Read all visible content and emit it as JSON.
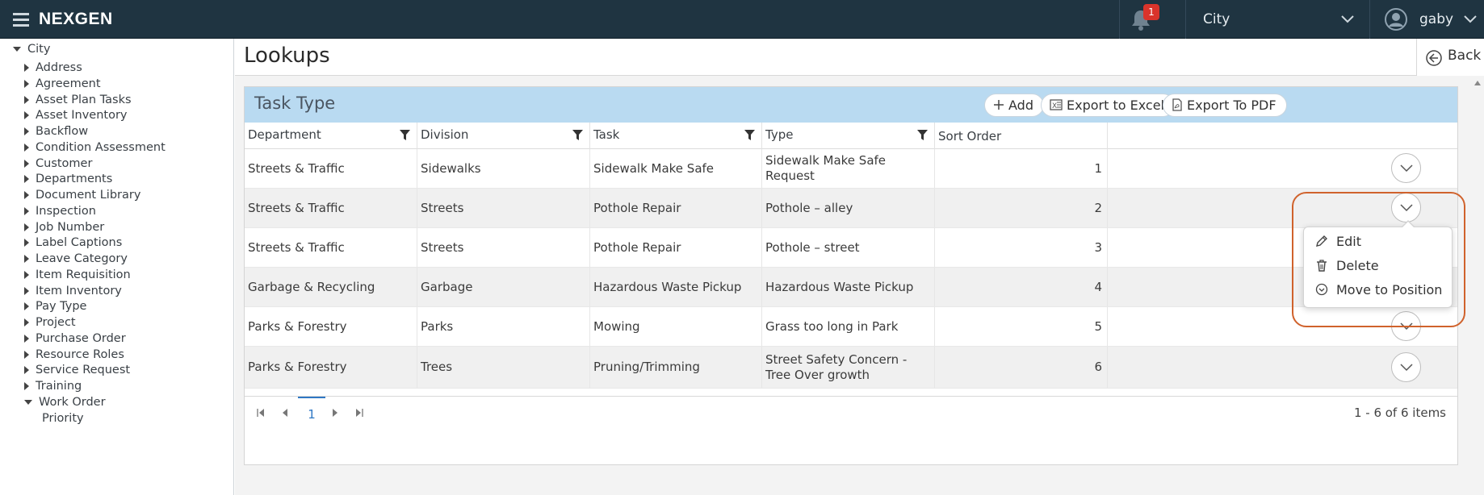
{
  "header": {
    "app_name": "NEXGEN",
    "notification_count": "1",
    "city_select_value": "City",
    "user_name": "gaby"
  },
  "sidebar": {
    "root_label": "City",
    "items": [
      {
        "label": "Address",
        "expanded": false
      },
      {
        "label": "Agreement",
        "expanded": false
      },
      {
        "label": "Asset Plan Tasks",
        "expanded": false
      },
      {
        "label": "Asset Inventory",
        "expanded": false
      },
      {
        "label": "Backflow",
        "expanded": false
      },
      {
        "label": "Condition Assessment",
        "expanded": false
      },
      {
        "label": "Customer",
        "expanded": false
      },
      {
        "label": "Departments",
        "expanded": false
      },
      {
        "label": "Document Library",
        "expanded": false
      },
      {
        "label": "Inspection",
        "expanded": false
      },
      {
        "label": "Job Number",
        "expanded": false
      },
      {
        "label": "Label Captions",
        "expanded": false
      },
      {
        "label": "Leave Category",
        "expanded": false
      },
      {
        "label": "Item Requisition",
        "expanded": false
      },
      {
        "label": "Item Inventory",
        "expanded": false
      },
      {
        "label": "Pay Type",
        "expanded": false
      },
      {
        "label": "Project",
        "expanded": false
      },
      {
        "label": "Purchase Order",
        "expanded": false
      },
      {
        "label": "Resource Roles",
        "expanded": false
      },
      {
        "label": "Service Request",
        "expanded": false
      },
      {
        "label": "Training",
        "expanded": false
      },
      {
        "label": "Work Order",
        "expanded": true
      }
    ],
    "child_items": [
      "Priority"
    ]
  },
  "page": {
    "title": "Lookups",
    "back_label": "Back"
  },
  "grid": {
    "title": "Task Type",
    "add_label": "Add",
    "export_excel_label": "Export to Excel",
    "export_pdf_label": "Export To PDF",
    "columns": [
      "Department",
      "Division",
      "Task",
      "Type",
      "Sort Order"
    ],
    "rows": [
      {
        "department": "Streets & Traffic",
        "division": "Sidewalks",
        "task": "Sidewalk Make Safe",
        "type": "Sidewalk Make Safe Request",
        "sort_order": "1"
      },
      {
        "department": "Streets & Traffic",
        "division": "Streets",
        "task": "Pothole Repair",
        "type": "Pothole – alley",
        "sort_order": "2"
      },
      {
        "department": "Streets & Traffic",
        "division": "Streets",
        "task": "Pothole Repair",
        "type": "Pothole – street",
        "sort_order": "3"
      },
      {
        "department": "Garbage & Recycling",
        "division": "Garbage",
        "task": "Hazardous Waste Pickup",
        "type": "Hazardous Waste Pickup",
        "sort_order": "4"
      },
      {
        "department": "Parks & Forestry",
        "division": "Parks",
        "task": "Mowing",
        "type": "Grass too long in Park",
        "sort_order": "5"
      },
      {
        "department": "Parks & Forestry",
        "division": "Trees",
        "task": "Pruning/Trimming",
        "type": "Street Safety Concern - Tree Over growth",
        "sort_order": "6"
      }
    ],
    "pager": {
      "current_page": "1",
      "info": "1 - 6 of 6 items"
    }
  },
  "row_menu": {
    "items": [
      {
        "label": "Edit",
        "icon": "pencil-icon"
      },
      {
        "label": "Delete",
        "icon": "trash-icon"
      },
      {
        "label": "Move to Position",
        "icon": "circle-chevron-down-icon"
      }
    ]
  },
  "colors": {
    "topbar": "#1f3441",
    "toolbar": "#b9daf1",
    "accent": "#2f78c4",
    "highlight": "#d0622c",
    "badge": "#d9342b"
  }
}
